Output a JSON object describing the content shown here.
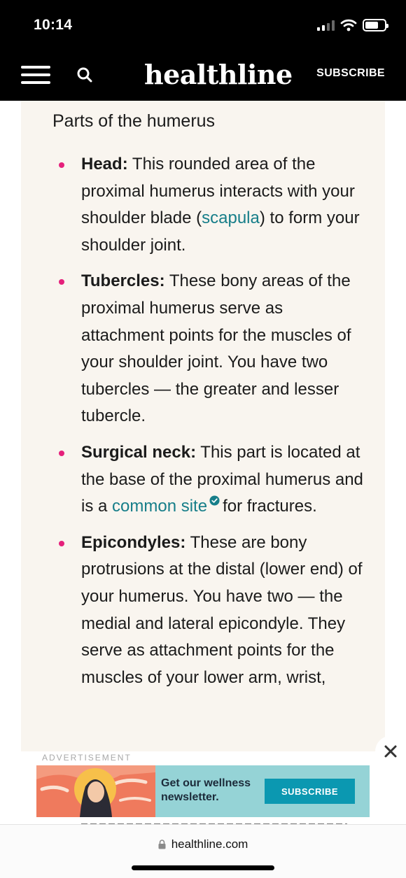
{
  "status_bar": {
    "time": "10:14"
  },
  "header": {
    "logo": "healthline",
    "subscribe_label": "SUBSCRIBE"
  },
  "callout": {
    "title": "Parts of the humerus",
    "items": [
      {
        "term": "Head:",
        "text_before": " This rounded area of the proximal humerus interacts with your shoulder blade (",
        "link": "scapula",
        "text_after": ") to form your shoulder joint."
      },
      {
        "term": "Tubercles:",
        "text_before": " These bony areas of the proximal humerus serve as attachment points for the muscles of your shoulder joint. You have two tubercles — the greater and lesser tubercle."
      },
      {
        "term": "Surgical neck:",
        "text_before": " This part is located at the base of the proximal humerus and is a ",
        "link": "common site",
        "text_after": "for fractures."
      },
      {
        "term": "Epicondyles:",
        "text_before": " These are bony protrusions at the distal (lower end) of your humerus. You have two — the medial and lateral epicondyle. They serve as attachment points for the muscles of your lower arm, wrist,"
      }
    ]
  },
  "ad": {
    "label": "ADVERTISEMENT",
    "text": "Get our wellness newsletter.",
    "button": "SUBSCRIBE"
  },
  "browser": {
    "url": "healthline.com"
  },
  "colors": {
    "bullet": "#e5207b",
    "link": "#177e89",
    "callout_bg": "#f9f5ef",
    "ad_bg": "#95d3d6",
    "ad_button": "#0b98b1"
  },
  "icons": [
    "signal-icon",
    "wifi-icon",
    "battery-icon",
    "menu-icon",
    "search-icon",
    "verified-icon",
    "close-icon",
    "lock-icon"
  ]
}
